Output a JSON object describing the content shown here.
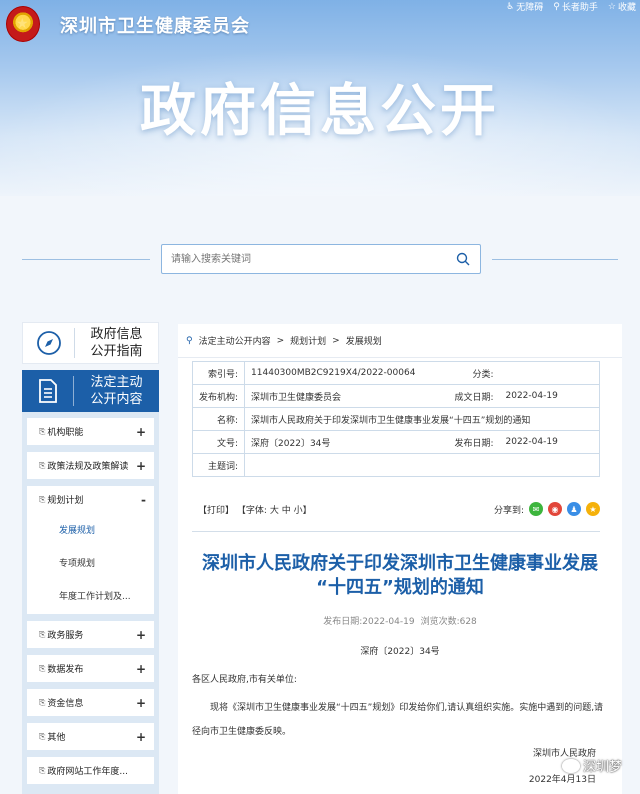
{
  "header": {
    "site_title": "深圳市卫生健康委员会",
    "accessibility_link": "无障碍",
    "elder_mode_link": "长者助手",
    "favorite_link": "收藏",
    "banner_title": "政府信息公开"
  },
  "search": {
    "placeholder": "请输入搜索关键词"
  },
  "sidebar": {
    "guide_label_1": "政府信息",
    "guide_label_2": "公开指南",
    "active_label_1": "法定主动",
    "active_label_2": "公开内容",
    "items": [
      {
        "label": "机构职能",
        "toggle": "+"
      },
      {
        "label": "政策法规及政策解读",
        "toggle": "+"
      },
      {
        "label": "规划计划",
        "toggle": "-"
      },
      {
        "label": "政务服务",
        "toggle": "+"
      },
      {
        "label": "数据发布",
        "toggle": "+"
      },
      {
        "label": "资金信息",
        "toggle": "+"
      },
      {
        "label": "其他",
        "toggle": "+"
      },
      {
        "label": "政府网站工作年度...",
        "toggle": ""
      }
    ],
    "sub_items": [
      "发展规划",
      "专项规划",
      "年度工作计划及..."
    ]
  },
  "breadcrumb": {
    "items": [
      "法定主动公开内容",
      "规划计划",
      "发展规划"
    ],
    "separator": ">"
  },
  "meta": {
    "index_key": "索引号:",
    "index_value": "11440300MB2C9219X4/2022-00064",
    "category_key": "分类:",
    "category_value": "",
    "publisher_key": "发布机构:",
    "publisher_value": "深圳市卫生健康委员会",
    "created_key": "成文日期:",
    "created_value": "2022-04-19",
    "name_key": "名称:",
    "name_value": "深圳市人民政府关于印发深圳市卫生健康事业发展“十四五”规划的通知",
    "docno_key": "文号:",
    "docno_value": "深府〔2022〕34号",
    "published_key": "发布日期:",
    "published_value": "2022-04-19",
    "keywords_key": "主题词:",
    "keywords_value": ""
  },
  "tools": {
    "print": "【打印】",
    "font_label": "【字体:",
    "font_large": "大",
    "font_medium": "中",
    "font_small": "小】",
    "share_label": "分享到:"
  },
  "article": {
    "title_line1": "深圳市人民政府关于印发深圳市卫生健康事业发展",
    "title_line2": "“十四五”规划的通知",
    "pub_date_label": "发布日期:",
    "pub_date": "2022-04-19",
    "views_label": "浏览次数:",
    "views": "628",
    "doc_number": "深府〔2022〕34号",
    "salutation": "各区人民政府,市有关单位:",
    "body": "现将《深圳市卫生健康事业发展“十四五”规划》印发给你们,请认真组织实施。实施中遇到的问题,请径向市卫生健康委反映。",
    "signature": "深圳市人民政府",
    "sign_date": "2022年4月13日"
  },
  "watermark": {
    "text": "深圳梦"
  },
  "colors": {
    "primary": "#1c5fa8",
    "banner_top": "#7fb1e6",
    "menu_bg": "#dce8f4"
  }
}
